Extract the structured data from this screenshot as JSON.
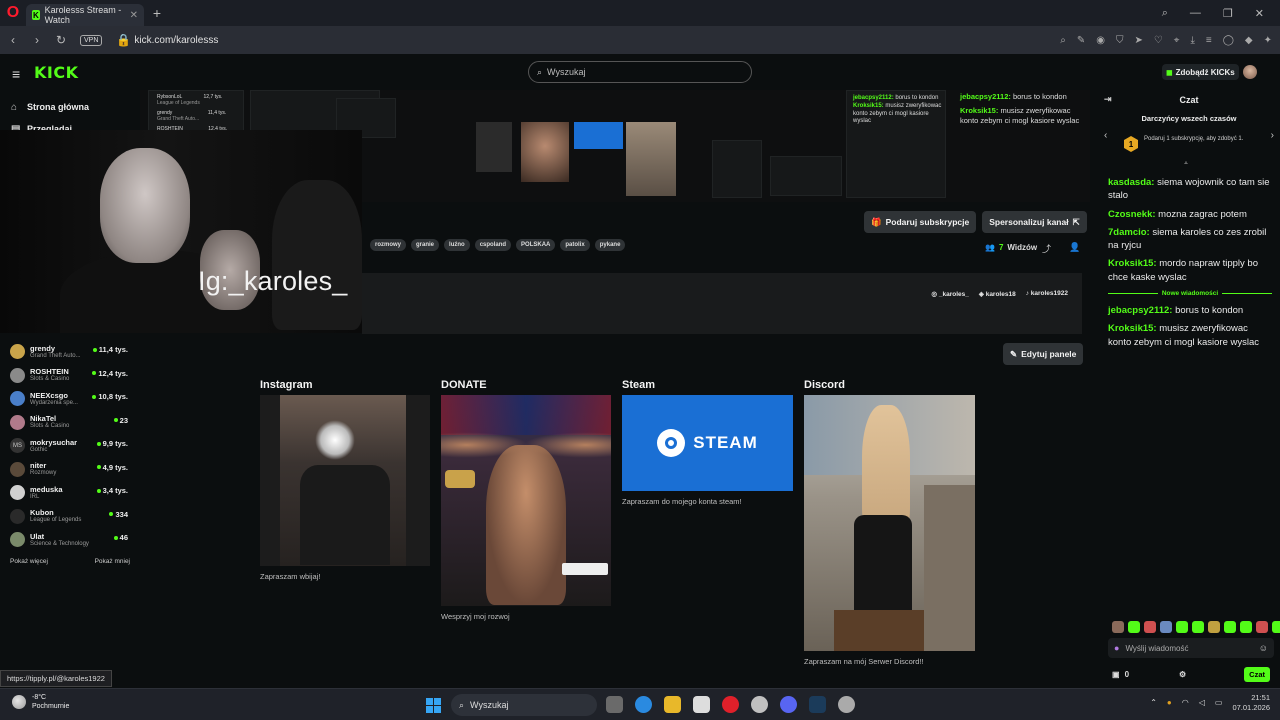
{
  "browser": {
    "tab_title": "Karolesss Stream - Watch",
    "url": "kick.com/karolesss",
    "vpn": "VPN",
    "status_url": "https://tipply.pl/@karoles1922"
  },
  "header": {
    "logo": "KICK",
    "search_placeholder": "Wyszukaj",
    "kicks_button": "Zdobądź KICKs"
  },
  "sidebar": {
    "nav": [
      {
        "label": "Strona główna",
        "icon": "home-icon"
      },
      {
        "label": "Przeglądaj",
        "icon": "browse-icon"
      }
    ],
    "channels": [
      {
        "name": "grendy",
        "category": "Grand Theft Auto...",
        "viewers": "11,4 tys."
      },
      {
        "name": "ROSHTEIN",
        "category": "Slots & Casino",
        "viewers": "12,4 tys."
      },
      {
        "name": "NEEXcsgo",
        "category": "Wydarzenia spe...",
        "viewers": "10,8 tys."
      },
      {
        "name": "NikaTel",
        "category": "Slots & Casino",
        "viewers": "23"
      },
      {
        "name": "mokrysuchar",
        "category": "Gothic",
        "viewers": "9,9 tys."
      },
      {
        "name": "niter",
        "category": "Rozmowy",
        "viewers": "4,9 tys."
      },
      {
        "name": "meduska",
        "category": "IRL",
        "viewers": "3,4 tys."
      },
      {
        "name": "Kubon",
        "category": "League of Legends",
        "viewers": "334"
      },
      {
        "name": "Ulat",
        "category": "Science & Technology",
        "viewers": "46"
      }
    ],
    "show_more": "Pokaż więcej",
    "show_less": "Pokaż mniej"
  },
  "stream": {
    "overlay_text": "Ig:_karoles_",
    "mini_list": [
      {
        "name": "RybsonLoL",
        "cat": "League of Legends",
        "v": "12,7 tys."
      },
      {
        "name": "grendy",
        "cat": "Grand Theft Auto...",
        "v": "11,4 tys."
      },
      {
        "name": "ROSHTEIN",
        "cat": "",
        "v": "12,4 tys."
      }
    ],
    "mini_chat": [
      {
        "user": "jebacpsy2112:",
        "text": "borus to kondon"
      },
      {
        "user": "Kroksik15:",
        "text": "musisz zweryfikowac konto zebym ci mogl kasiore wyslac"
      }
    ],
    "mini_chat_right": [
      {
        "user": "jebacpsy2112:",
        "text": "borus to kondon"
      },
      {
        "user": "Kroksik15:",
        "text": "musisz zweryfikowac konto zebym ci mogl kasiore wyslac"
      }
    ]
  },
  "actions": {
    "gift_sub": "Podaruj subskrypcje",
    "customize": "Spersonalizuj kanał",
    "edit_panel": "Edytuj panele"
  },
  "tags": [
    "rozmowy",
    "granie",
    "luźno",
    "cspoland",
    "POLSKAA",
    "patolix",
    "pykane"
  ],
  "viewers_count": "7",
  "viewers_label": "Widzów",
  "socials": [
    "_karoles_",
    "karoles18",
    "karoles1922"
  ],
  "panels": [
    {
      "title": "Instagram",
      "caption": "Zapraszam wbijaj!"
    },
    {
      "title": "DONATE",
      "caption": "Wesprzyj moj rozwoj"
    },
    {
      "title": "Steam",
      "caption": "Zapraszam do mojego konta steam!",
      "logo_text": "STEAM"
    },
    {
      "title": "Discord",
      "caption": "Zapraszam na mój Serwer Discord!!"
    }
  ],
  "chat": {
    "title": "Czat",
    "gifters_title": "Darczyńcy wszech czasów",
    "gifter_rank": "1",
    "gifter_text": "Podaruj 1 subskrypcję, aby zdobyć 1.",
    "messages": [
      {
        "user": "kasdasda:",
        "text": "siema wojownik co tam sie stalo"
      },
      {
        "user": "Czosnekk:",
        "text": "mozna zagrac potem"
      },
      {
        "user": "7damcio:",
        "text": "siema karoles co zes zrobil na ryjcu"
      },
      {
        "user": "Kroksik15:",
        "text": "mordo napraw tipply bo chce kaske wyslac"
      }
    ],
    "new_messages": "Nowe wiadomości",
    "new": [
      {
        "user": "jebacpsy2112:",
        "text": "borus to kondon"
      },
      {
        "user": "Kroksik15:",
        "text": "musisz zweryfikowac konto zebym ci mogl kasiore wyslac"
      }
    ],
    "input_placeholder": "Wyślij wiadomość",
    "kicks_count": "0",
    "send": "Czat"
  },
  "taskbar": {
    "temp": "-8°C",
    "weather": "Pochmurnie",
    "search": "Wyszukaj",
    "time": "21:51",
    "date": "07.01.2026"
  },
  "colors": {
    "accent": "#53fc18",
    "bg": "#0b0e0f",
    "panel": "#191b1c",
    "button": "#2f3336",
    "steam": "#1a6fd4"
  }
}
